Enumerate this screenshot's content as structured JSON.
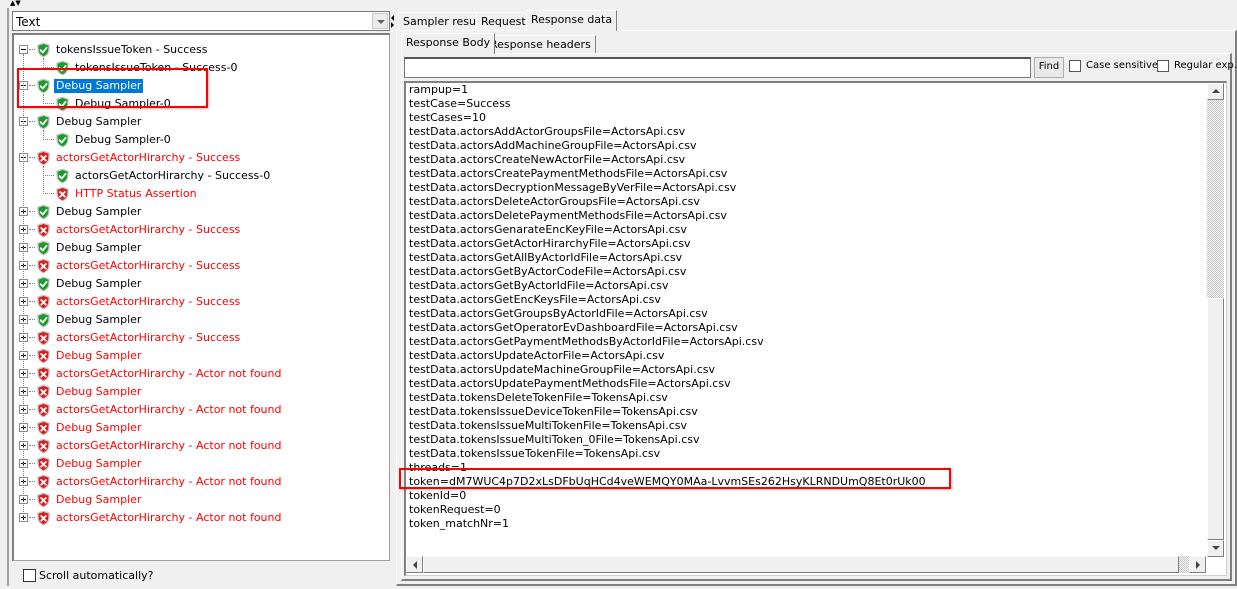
{
  "left_panel": {
    "renderer_select": {
      "value": "Text"
    },
    "tree": [
      {
        "label": "tokensIssueToken - Success",
        "level": 0,
        "expanded": true,
        "status": "success",
        "selected": false
      },
      {
        "label": "tokensIssueToken - Success-0",
        "level": 1,
        "status": "success",
        "selected": false
      },
      {
        "label": "Debug Sampler",
        "level": 0,
        "expanded": true,
        "status": "success",
        "selected": true
      },
      {
        "label": "Debug Sampler-0",
        "level": 1,
        "status": "success",
        "selected": false
      },
      {
        "label": "Debug Sampler",
        "level": 0,
        "expanded": true,
        "status": "success",
        "selected": false
      },
      {
        "label": "Debug Sampler-0",
        "level": 1,
        "status": "success",
        "selected": false
      },
      {
        "label": "actorsGetActorHirarchy - Success",
        "level": 0,
        "expanded": true,
        "status": "failure",
        "selected": false
      },
      {
        "label": "actorsGetActorHirarchy - Success-0",
        "level": 1,
        "status": "success",
        "selected": false
      },
      {
        "label": "HTTP Status Assertion",
        "level": 1,
        "status": "failure",
        "selected": false
      },
      {
        "label": "Debug Sampler",
        "level": 0,
        "expanded": false,
        "status": "success",
        "selected": false
      },
      {
        "label": "actorsGetActorHirarchy - Success",
        "level": 0,
        "expanded": false,
        "status": "failure",
        "selected": false
      },
      {
        "label": "Debug Sampler",
        "level": 0,
        "expanded": false,
        "status": "success",
        "selected": false
      },
      {
        "label": "actorsGetActorHirarchy - Success",
        "level": 0,
        "expanded": false,
        "status": "failure",
        "selected": false
      },
      {
        "label": "Debug Sampler",
        "level": 0,
        "expanded": false,
        "status": "success",
        "selected": false
      },
      {
        "label": "actorsGetActorHirarchy - Success",
        "level": 0,
        "expanded": false,
        "status": "failure",
        "selected": false
      },
      {
        "label": "Debug Sampler",
        "level": 0,
        "expanded": false,
        "status": "success",
        "selected": false
      },
      {
        "label": "actorsGetActorHirarchy - Success",
        "level": 0,
        "expanded": false,
        "status": "failure",
        "selected": false
      },
      {
        "label": "Debug Sampler",
        "level": 0,
        "expanded": false,
        "status": "failure",
        "selected": false
      },
      {
        "label": "actorsGetActorHirarchy - Actor not found",
        "level": 0,
        "expanded": false,
        "status": "failure",
        "selected": false
      },
      {
        "label": "Debug Sampler",
        "level": 0,
        "expanded": false,
        "status": "failure",
        "selected": false
      },
      {
        "label": "actorsGetActorHirarchy - Actor not found",
        "level": 0,
        "expanded": false,
        "status": "failure",
        "selected": false
      },
      {
        "label": "Debug Sampler",
        "level": 0,
        "expanded": false,
        "status": "failure",
        "selected": false
      },
      {
        "label": "actorsGetActorHirarchy - Actor not found",
        "level": 0,
        "expanded": false,
        "status": "failure",
        "selected": false
      },
      {
        "label": "Debug Sampler",
        "level": 0,
        "expanded": false,
        "status": "failure",
        "selected": false
      },
      {
        "label": "actorsGetActorHirarchy - Actor not found",
        "level": 0,
        "expanded": false,
        "status": "failure",
        "selected": false
      },
      {
        "label": "Debug Sampler",
        "level": 0,
        "expanded": false,
        "status": "failure",
        "selected": false
      },
      {
        "label": "actorsGetActorHirarchy - Actor not found",
        "level": 0,
        "expanded": false,
        "status": "failure",
        "selected": false
      }
    ],
    "scroll_automatically": {
      "label": "Scroll automatically?",
      "checked": false
    }
  },
  "right_panel": {
    "tabs": [
      {
        "label": "Sampler result",
        "active": false
      },
      {
        "label": "Request",
        "active": false
      },
      {
        "label": "Response data",
        "active": true
      }
    ],
    "subtabs": [
      {
        "label": "Response Body",
        "active": true
      },
      {
        "label": "Response headers",
        "active": false
      }
    ],
    "search": {
      "value": "",
      "find_label": "Find",
      "case_sensitive": {
        "label": "Case sensitive",
        "checked": false
      },
      "regex": {
        "label": "Regular exp.",
        "checked": false
      }
    },
    "response_lines": [
      "rampup=1",
      "testCase=Success",
      "testCases=10",
      "testData.actorsAddActorGroupsFile=ActorsApi.csv",
      "testData.actorsAddMachineGroupFile=ActorsApi.csv",
      "testData.actorsCreateNewActorFile=ActorsApi.csv",
      "testData.actorsCreatePaymentMethodsFile=ActorsApi.csv",
      "testData.actorsDecryptionMessageByVerFile=ActorsApi.csv",
      "testData.actorsDeleteActorGroupsFile=ActorsApi.csv",
      "testData.actorsDeletePaymentMethodsFile=ActorsApi.csv",
      "testData.actorsGenarateEncKeyFile=ActorsApi.csv",
      "testData.actorsGetActorHirarchyFile=ActorsApi.csv",
      "testData.actorsGetAllByActorIdFile=ActorsApi.csv",
      "testData.actorsGetByActorCodeFile=ActorsApi.csv",
      "testData.actorsGetByActorIdFile=ActorsApi.csv",
      "testData.actorsGetEncKeysFile=ActorsApi.csv",
      "testData.actorsGetGroupsByActorIdFile=ActorsApi.csv",
      "testData.actorsGetOperatorEvDashboardFile=ActorsApi.csv",
      "testData.actorsGetPaymentMethodsByActorIdFile=ActorsApi.csv",
      "testData.actorsUpdateActorFile=ActorsApi.csv",
      "testData.actorsUpdateMachineGroupFile=ActorsApi.csv",
      "testData.actorsUpdatePaymentMethodsFile=ActorsApi.csv",
      "testData.tokensDeleteTokenFile=TokensApi.csv",
      "testData.tokensIssueDeviceTokenFile=TokensApi.csv",
      "testData.tokensIssueMultiTokenFile=TokensApi.csv",
      "testData.tokensIssueMultiToken_0File=TokensApi.csv",
      "testData.tokensIssueTokenFile=TokensApi.csv",
      "threads=1",
      "token=dM7WUC4p7D2xLsDFbUqHCd4veWEMQY0MAa-LvvmSEs262HsyKLRNDUmQ8Et0rUk00",
      "tokenId=0",
      "tokenRequest=0",
      "token_matchNr=1"
    ],
    "vertical_scroll_position": 0.45,
    "vertical_scroll_visible_fraction": 0.55
  },
  "colors": {
    "success": "#1a9b2a",
    "failure": "#d42020",
    "failure_text": "#ff0000",
    "selection": "#0078d7",
    "annotation_box": "#ff0000"
  }
}
